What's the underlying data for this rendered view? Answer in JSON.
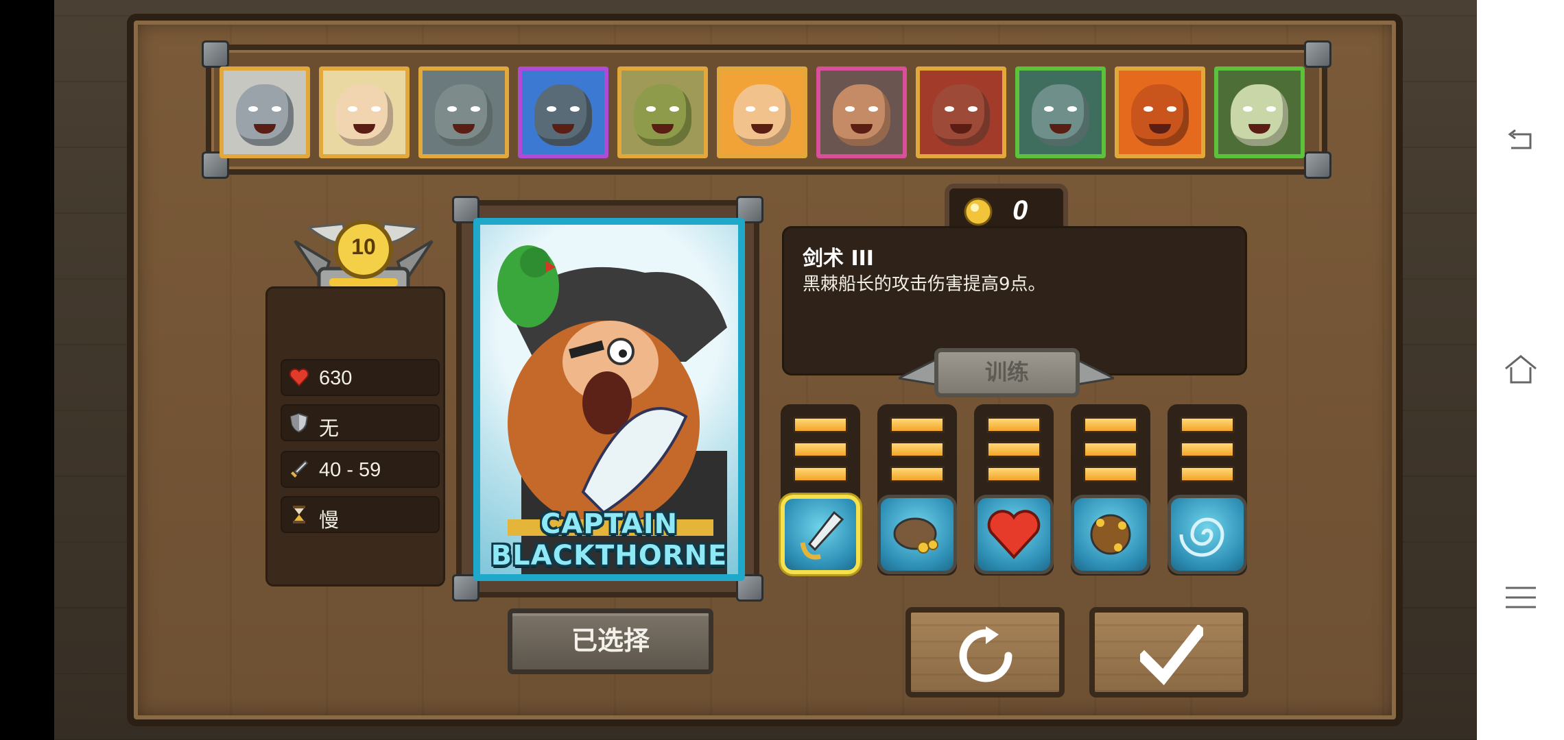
{
  "heroes": [
    {
      "name": "wizard",
      "frame": "#e3a83b",
      "bg": "#c7c7c2",
      "skin": "#9aa3a9"
    },
    {
      "name": "priestess",
      "frame": "#e3a83b",
      "bg": "#e9d8a2",
      "skin": "#f1d5b0"
    },
    {
      "name": "stone-golem",
      "frame": "#e3a83b",
      "bg": "#6b7a7c",
      "skin": "#7d8c8a"
    },
    {
      "name": "storm-golem",
      "frame": "#b04bd6",
      "bg": "#3c79d2",
      "skin": "#5a6b78"
    },
    {
      "name": "crocodile",
      "frame": "#e3a83b",
      "bg": "#9f9a57",
      "skin": "#8e9b4a"
    },
    {
      "name": "monk",
      "frame": "#e3a83b",
      "bg": "#f2a337",
      "skin": "#f2c28c"
    },
    {
      "name": "captain-blackthorne",
      "frame": "#d94f9a",
      "bg": "#6a5550",
      "skin": "#c48b66"
    },
    {
      "name": "fire-brute",
      "frame": "#e3a83b",
      "bg": "#a33b2a",
      "skin": "#9d4a38"
    },
    {
      "name": "ogre",
      "frame": "#5cc23b",
      "bg": "#3f6e5e",
      "skin": "#6e8f8a"
    },
    {
      "name": "dragon",
      "frame": "#e3a83b",
      "bg": "#e66a1e",
      "skin": "#c9541c"
    },
    {
      "name": "bone-dragon",
      "frame": "#5cc23b",
      "bg": "#4d6e36",
      "skin": "#c9d6a8"
    }
  ],
  "level": {
    "value": "10"
  },
  "stats": [
    {
      "icon": "heart-icon",
      "value": "630"
    },
    {
      "icon": "shield-icon",
      "value": "无"
    },
    {
      "icon": "sword-icon",
      "value": "40 - 59"
    },
    {
      "icon": "hourglass-icon",
      "value": "慢"
    }
  ],
  "card": {
    "name": "CAPTAIN\nBLACKTHORNE"
  },
  "selected_label": "已选择",
  "gems": {
    "count": "0"
  },
  "skill": {
    "title": "剑术 III",
    "description": "黑棘船长的攻击伤害提高9点。"
  },
  "train_label": "训练",
  "skills": [
    {
      "name": "sword-skill",
      "level": 3,
      "selected": true
    },
    {
      "name": "treasure-bag-skill",
      "level": 3,
      "selected": false
    },
    {
      "name": "heart-skill",
      "level": 3,
      "selected": false
    },
    {
      "name": "bomb-skill",
      "level": 3,
      "selected": false
    },
    {
      "name": "whirlpool-skill",
      "level": 3,
      "selected": false
    }
  ],
  "colors": {
    "pip": "#f3a328",
    "card_border": "#1fa8c9",
    "selected_outline": "#f6e04c"
  }
}
